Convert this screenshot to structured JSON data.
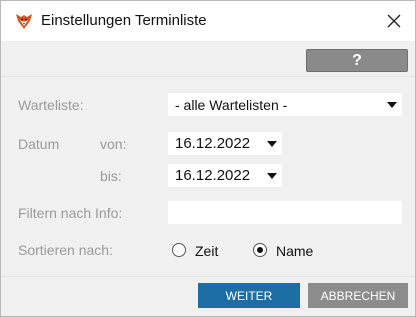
{
  "window": {
    "title": "Einstellungen Terminliste"
  },
  "toolbar": {
    "help_label": "?"
  },
  "form": {
    "warteliste": {
      "label": "Warteliste:",
      "value": "- alle Wartelisten -"
    },
    "datum": {
      "label": "Datum",
      "von_label": "von:",
      "von_value": "16.12.2022",
      "bis_label": "bis:",
      "bis_value": "16.12.2022"
    },
    "filter": {
      "label": "Filtern nach Info:",
      "value": ""
    },
    "sort": {
      "label": "Sortieren nach:",
      "options": [
        {
          "label": "Zeit",
          "selected": false
        },
        {
          "label": "Name",
          "selected": true
        }
      ]
    }
  },
  "footer": {
    "next_label": "WEITER",
    "cancel_label": "ABBRECHEN"
  },
  "colors": {
    "primary_button": "#1c6ea4",
    "secondary_button": "#8c8c8c",
    "dialog_background": "#f0f0f0",
    "label_text": "#9a9a9a"
  },
  "icons": {
    "app": "fox-icon",
    "close": "close-icon",
    "dropdown": "caret-down-icon"
  }
}
